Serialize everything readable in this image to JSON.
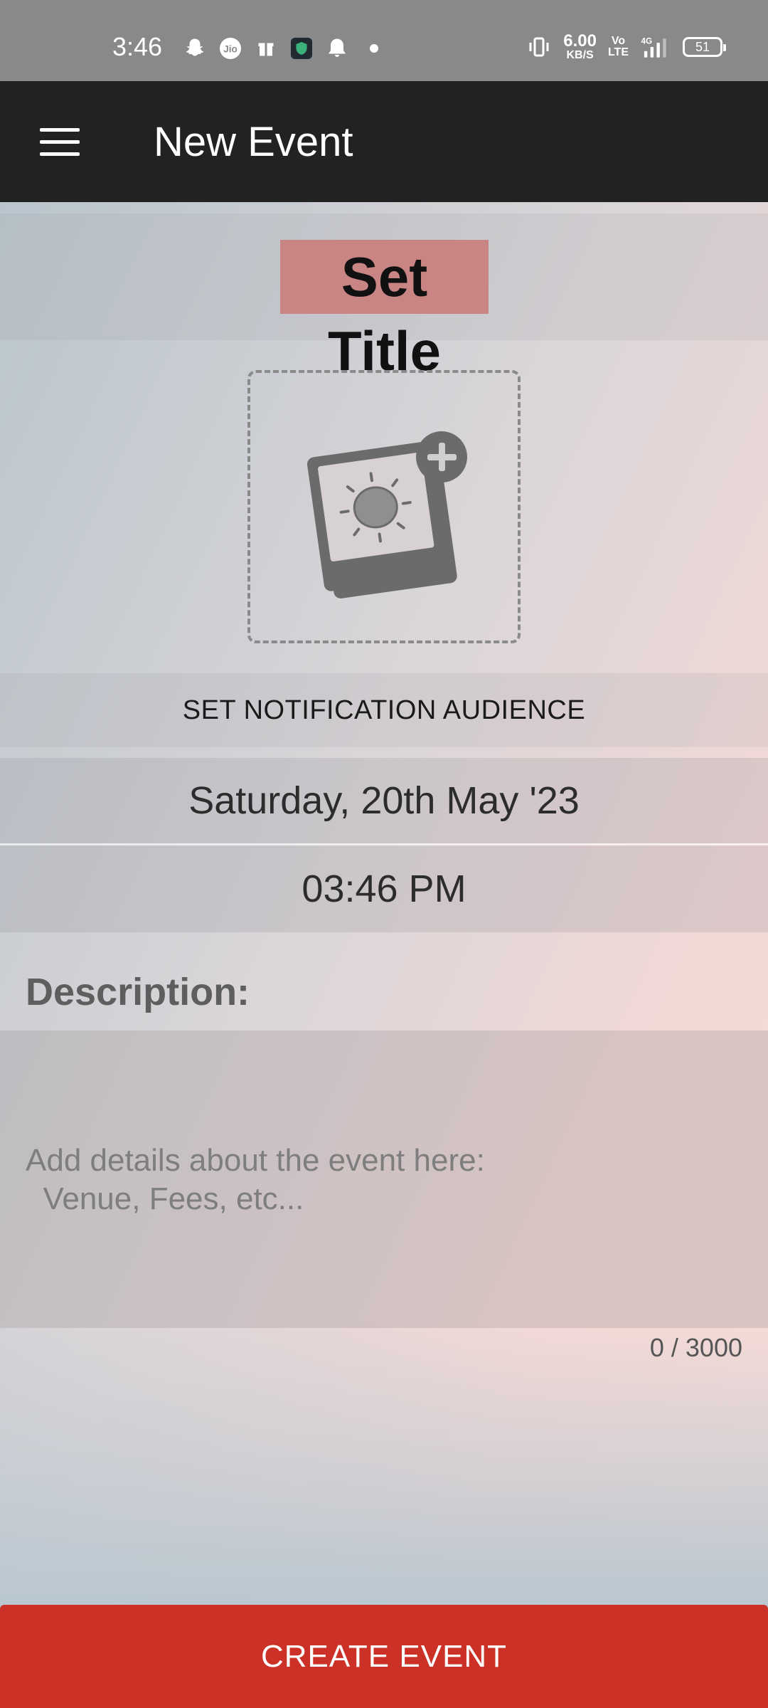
{
  "status_bar": {
    "time": "3:46",
    "net_speed_value": "6.00",
    "net_speed_unit": "KB/S",
    "volte_line1": "Vo",
    "volte_line2": "LTE",
    "network": "4G",
    "battery": "51",
    "left_icons": [
      "snapchat-icon",
      "jio-icon",
      "gift-icon",
      "shield-app-icon",
      "bell-icon"
    ]
  },
  "app_bar": {
    "title": "New Event"
  },
  "form": {
    "title_placeholder": "Set Title",
    "audience_label": "SET NOTIFICATION AUDIENCE",
    "date": "Saturday, 20th May '23",
    "time": "03:46 PM",
    "description_heading": "Description:",
    "description_placeholder": "Add details about the event here:\n  Venue, Fees, etc...",
    "char_count": "0 / 3000"
  },
  "actions": {
    "create_label": "CREATE EVENT"
  },
  "colors": {
    "app_bar": "#222222",
    "title_highlight": "#c98484",
    "primary_button": "#cc3128"
  }
}
